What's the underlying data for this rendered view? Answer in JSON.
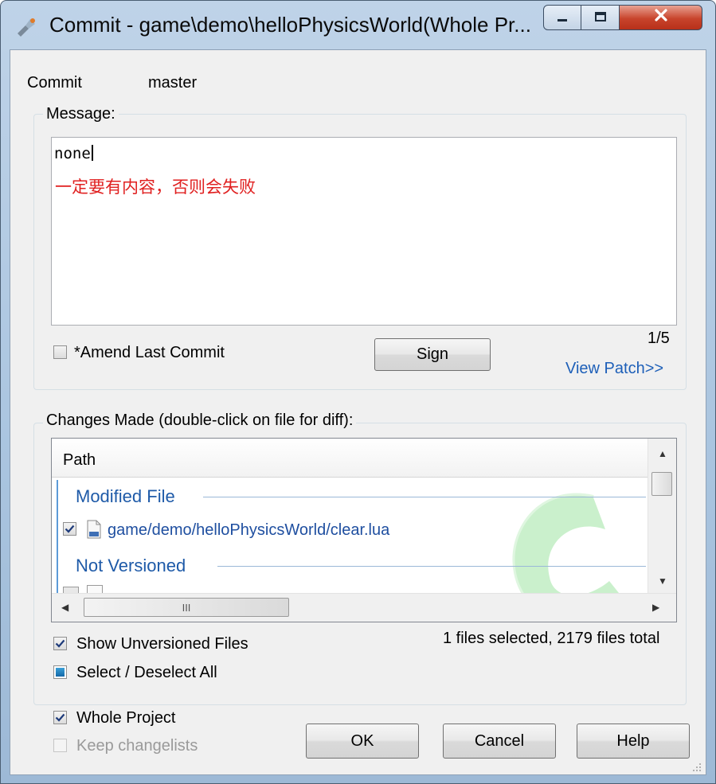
{
  "window": {
    "title": "Commit - game\\demo\\helloPhysicsWorld(Whole Pr...",
    "icon": "tortoisegit-commit-icon",
    "controls": {
      "minimize": "minimize-icon",
      "maximize": "maximize-icon",
      "close": "close-icon"
    }
  },
  "commit": {
    "label": "Commit",
    "branch": "master"
  },
  "message": {
    "caption": "Message:",
    "line1": "none",
    "line2": "一定要有内容，否则会失败",
    "line2_color": "#e02020",
    "counter": "1/5",
    "amend_label": "*Amend Last Commit",
    "amend_checked": false,
    "sign_label": "Sign",
    "view_patch": "View Patch>>"
  },
  "changes": {
    "caption": "Changes Made (double-click on file for diff):",
    "column_path": "Path",
    "groups": [
      {
        "title": "Modified File"
      },
      {
        "title": "Not Versioned"
      }
    ],
    "files": [
      {
        "path": "game/demo/helloPhysicsWorld/clear.lua",
        "checked": true
      }
    ],
    "scroll_h_glyph": "III",
    "show_unversioned_label": "Show Unversioned Files",
    "show_unversioned_checked": true,
    "select_all_label": "Select / Deselect All",
    "status": "1 files selected, 2179 files total"
  },
  "footer": {
    "whole_project_label": "Whole Project",
    "whole_project_checked": true,
    "keep_changelists_label": "Keep changelists",
    "ok_label": "OK",
    "cancel_label": "Cancel",
    "help_label": "Help"
  },
  "colors": {
    "accent_link": "#1d5fb8",
    "group_title": "#1e5aa8",
    "close_button": "#c8442c"
  }
}
